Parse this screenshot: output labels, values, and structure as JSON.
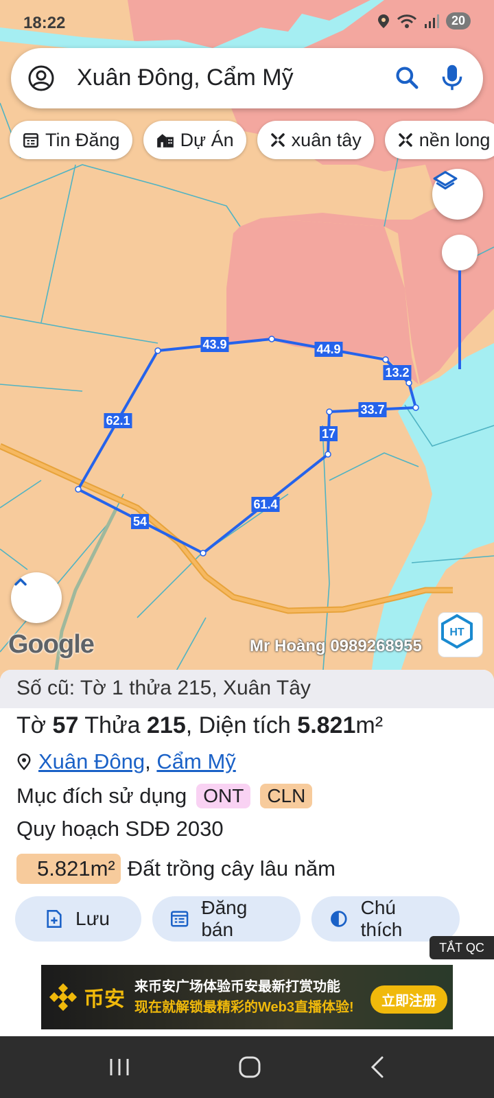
{
  "status_bar": {
    "time": "18:22",
    "battery": "20"
  },
  "search": {
    "query": "Xuân Đông, Cẩm Mỹ"
  },
  "chips": [
    {
      "icon": "calendar-list-icon",
      "label": "Tin Đăng"
    },
    {
      "icon": "buildings-icon",
      "label": "Dự Án"
    },
    {
      "icon": "cross-tool-icon",
      "label": "xuân tây"
    },
    {
      "icon": "cross-tool-icon",
      "label": "nền long"
    }
  ],
  "map": {
    "edge_labels": [
      "43.9",
      "44.9",
      "13.2",
      "33.7",
      "17",
      "61.4",
      "54",
      "62.1"
    ],
    "google_label": "Google",
    "watermark": "Mr Hoàng 0989268955",
    "logo_text": "HOÀNG THỊNH LAND",
    "colors": {
      "agri_land": "#f7cb9c",
      "residential": "#f3a79f",
      "water": "#a5eef2",
      "parcel_outline": "#2563eb",
      "road": "#e7a33b"
    }
  },
  "panel": {
    "old_record": "Số cũ: Tờ 1 thửa 215, Xuân Tây",
    "main": {
      "to_label": "Tờ",
      "to_value": "57",
      "thua_label": "Thửa",
      "thua_value": "215",
      "area_label": ", Diện tích",
      "area_value": "5.821",
      "area_unit": "m²"
    },
    "location": {
      "commune": "Xuân Đông",
      "sep": ",",
      "district": "Cẩm Mỹ"
    },
    "purpose_label": "Mục đích sử dụng",
    "purpose_tags": [
      "ONT",
      "CLN"
    ],
    "plan_label": "Quy hoạch SDĐ 2030",
    "plan_area": "5.821m²",
    "plan_desc": "Đất trồng cây lâu năm",
    "actions": [
      {
        "icon": "save-doc-icon",
        "label": "Lưu"
      },
      {
        "icon": "listing-icon",
        "label": "Đăng bán"
      },
      {
        "icon": "legend-icon",
        "label": "Chú thích"
      }
    ]
  },
  "ad": {
    "close_label": "TẮT QC",
    "brand": "币安",
    "line1": "来币安广场体验币安最新打赏功能",
    "line2": "现在就解锁最精彩的Web3直播体验!",
    "cta": "立即注册"
  }
}
